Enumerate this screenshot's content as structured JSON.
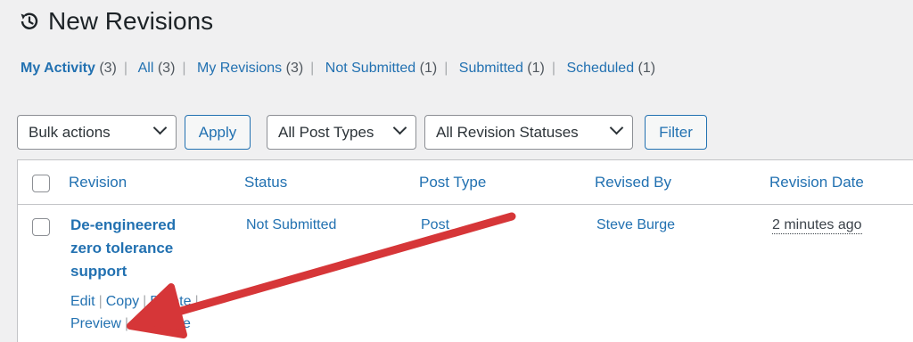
{
  "header": {
    "title": "New Revisions",
    "icon": "history-icon"
  },
  "filters": [
    {
      "label": "My Activity",
      "count": "(3)",
      "current": true
    },
    {
      "label": "All",
      "count": "(3)"
    },
    {
      "label": "My Revisions",
      "count": "(3)"
    },
    {
      "label": "Not Submitted",
      "count": "(1)"
    },
    {
      "label": "Submitted",
      "count": "(1)"
    },
    {
      "label": "Scheduled",
      "count": "(1)"
    }
  ],
  "toolbar": {
    "bulk_actions": "Bulk actions",
    "apply_label": "Apply",
    "post_types": "All Post Types",
    "revision_statuses": "All Revision Statuses",
    "filter_label": "Filter"
  },
  "table": {
    "columns": [
      "Revision",
      "Status",
      "Post Type",
      "Revised By",
      "Revision Date"
    ],
    "rows": [
      {
        "revision": "De-engineered zero tolerance support",
        "status": "Not Submitted",
        "post_type": "Post",
        "revised_by": "Steve Burge",
        "date": "2 minutes ago",
        "actions": [
          "Edit",
          "Copy",
          "Delete",
          "Preview",
          "Compare"
        ]
      }
    ]
  },
  "annotation": {
    "arrow_color": "#d63638",
    "icon": "red-arrow-icon"
  },
  "colors": {
    "link": "#2271b1",
    "background": "#f0f0f1",
    "border": "#c3c4c7"
  }
}
